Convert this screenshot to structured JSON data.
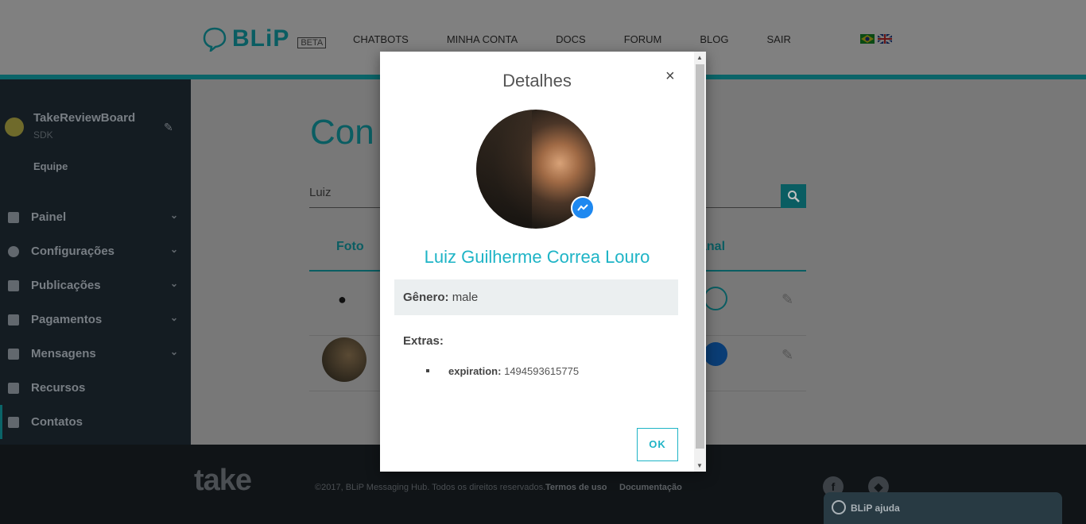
{
  "header": {
    "logo_text": "BLiP",
    "beta_label": "BETA",
    "nav": [
      {
        "label": "CHATBOTS"
      },
      {
        "label": "MINHA CONTA"
      },
      {
        "label": "DOCS"
      },
      {
        "label": "FORUM"
      },
      {
        "label": "BLOG"
      },
      {
        "label": "SAIR"
      }
    ],
    "flags": [
      "brazil-flag-icon",
      "uk-flag-icon"
    ]
  },
  "sidebar": {
    "account_name": "TakeReviewBoard",
    "account_sub": "SDK",
    "team_label": "Equipe",
    "items": [
      {
        "label": "Painel",
        "icon": "dashboard-icon",
        "chevron": "⌄"
      },
      {
        "label": "Configurações",
        "icon": "gear-icon",
        "chevron": "⌄"
      },
      {
        "label": "Publicações",
        "icon": "upload-icon",
        "chevron": "⌄"
      },
      {
        "label": "Pagamentos",
        "icon": "card-icon",
        "chevron": "⌄"
      },
      {
        "label": "Mensagens",
        "icon": "message-icon",
        "chevron": "⌄"
      },
      {
        "label": "Recursos",
        "icon": "resources-icon",
        "chevron": ""
      },
      {
        "label": "Contatos",
        "icon": "contacts-icon",
        "chevron": ""
      }
    ]
  },
  "main": {
    "title": "Con",
    "search_value": "Luiz",
    "table_headers": {
      "photo": "Foto",
      "channel": "anal"
    }
  },
  "modal": {
    "title": "Detalhes",
    "close_glyph": "×",
    "name": "Luiz Guilherme Correa Louro",
    "gender_label": "Gênero:",
    "gender_value": "male",
    "extras_label": "Extras:",
    "extras": [
      {
        "key": "expiration:",
        "value": "1494593615775"
      }
    ],
    "ok_label": "OK"
  },
  "footer": {
    "logo": "take",
    "copyright": "©2017, BLiP Messaging Hub. Todos os direitos reservados.",
    "terms": "Termos de uso",
    "docs": "Documentação",
    "help_label": "BLiP ajuda"
  },
  "colors": {
    "accent": "#1eb4c6",
    "messenger_blue": "#1e88f0",
    "sidebar_bg": "#141c22",
    "overlay": "#7f7f7f"
  }
}
